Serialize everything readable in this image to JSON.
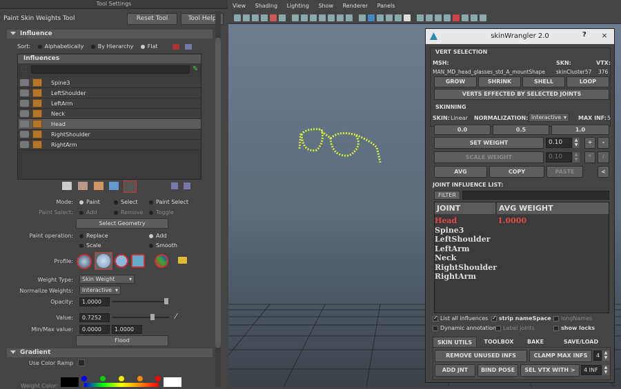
{
  "left_panel": {
    "window_title": "Tool Settings",
    "tool_name": "Paint Skin Weights Tool",
    "reset_tool": "Reset Tool",
    "tool_help": "Tool Help",
    "influence_section": "Influence",
    "sort_label": "Sort:",
    "sort_options": [
      "Alphabetically",
      "By Hierarchy",
      "Flat"
    ],
    "influences_header": "Influences",
    "influences": [
      "Spine3",
      "LeftShoulder",
      "LeftArm",
      "Neck",
      "Head",
      "RightShoulder",
      "RightArm"
    ],
    "selected_influence": "Head",
    "mode_label": "Mode:",
    "mode_options": [
      "Paint",
      "Select",
      "Paint Select"
    ],
    "paint_select_label": "Paint Select:",
    "paint_select_options": [
      "Add",
      "Remove",
      "Toggle"
    ],
    "select_geometry": "Select Geometry",
    "paint_operation_label": "Paint operation:",
    "paint_ops": [
      "Replace",
      "Add",
      "Scale",
      "Smooth"
    ],
    "profile_label": "Profile:",
    "weight_type_label": "Weight Type:",
    "weight_type": "Skin Weight",
    "normalize_label": "Normalize Weights:",
    "normalize": "Interactive",
    "opacity_label": "Opacity:",
    "opacity": "1.0000",
    "value_label": "Value:",
    "value": "0.7252",
    "minmax_label": "Min/Max value:",
    "min": "0.0000",
    "max": "1.0000",
    "flood": "Flood",
    "gradient_section": "Gradient",
    "use_color_ramp": "Use Color Ramp",
    "weight_color": "Weight Color:"
  },
  "viewport": {
    "menu": [
      "View",
      "Shading",
      "Lighting",
      "Show",
      "Renderer",
      "Panels"
    ]
  },
  "skinwrangler": {
    "title": "skinWrangler 2.0",
    "help": "?",
    "close": "×",
    "vert_selection": "VERT SELECTION",
    "msh_label": "MSH:",
    "skn_label": "SKN:",
    "vtx_label": "VTX:",
    "mesh": "MAN_MD_head_glasses_std_A_mountShape",
    "skin": "skinCluster57",
    "vtx": "376",
    "grow": "GROW",
    "shrink": "SHRINK",
    "shell": "SHELL",
    "loop": "LOOP",
    "verts_affected": "VERTS EFFECTED BY SELECTED JOINTS",
    "skinning": "SKINNING",
    "skin_label": "SKIN:",
    "skin_type": "Linear",
    "normalization_label": "NORMALIZATION:",
    "normalization": "Interactive",
    "max_inf_label": "MAX INF:",
    "max_inf": "5",
    "presets": [
      "0.0",
      "0.5",
      "1.0"
    ],
    "set_weight": "SET WEIGHT",
    "set_weight_val": "0.10",
    "scale_weight": "SCALE WEIGHT",
    "scale_weight_val": "0.10",
    "plus": "+",
    "minus": "-",
    "star": "*",
    "slash": "/",
    "avg": "AVG",
    "copy": "COPY",
    "paste": "PASTE",
    "arrow": "<",
    "joint_list_label": "JOINT INFLUENCE LIST:",
    "filter": "FILTER",
    "col_joint": "JOINT",
    "col_avg": "AVG WEIGHT",
    "joints": [
      "Head",
      "Spine3",
      "LeftShoulder",
      "LeftArm",
      "Neck",
      "RightShoulder",
      "RightArm"
    ],
    "head_weight": "1.0000",
    "list_all": "List all influences",
    "strip_ns": "strip nameSpace",
    "long_names": "longNames",
    "dynamic_ann": "Dynamic annotation",
    "label_joints": "Label joints",
    "show_locks": "show locks",
    "tabs": [
      "SKIN UTILS",
      "TOOLBOX",
      "BAKE",
      "SAVE/LOAD"
    ],
    "remove_unused": "REMOVE UNUSED INFS",
    "clamp_max": "CLAMP MAX INFS",
    "clamp_val": "4",
    "add_jnt": "ADD JNT",
    "bind_pose": "BIND POSE",
    "sel_vtx": "SEL VTX WITH >",
    "sel_val": "4 INF"
  }
}
